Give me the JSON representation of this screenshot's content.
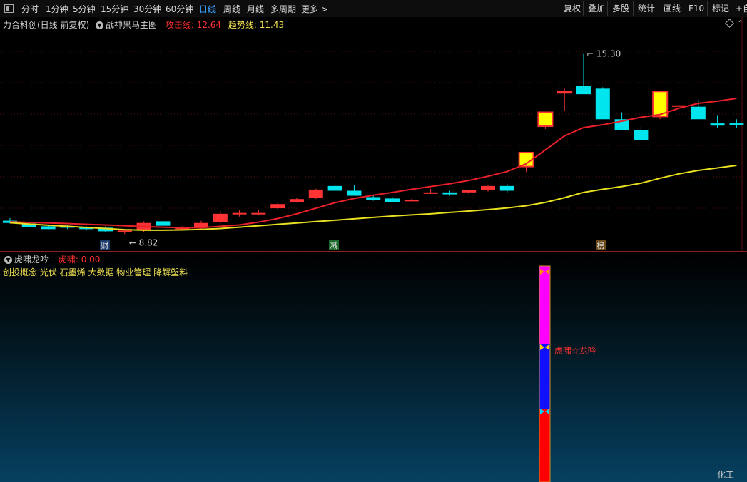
{
  "toolbar": {
    "periods": [
      "分时",
      "1分钟",
      "5分钟",
      "15分钟",
      "30分钟",
      "60分钟",
      "日线",
      "周线",
      "月线",
      "多周期",
      "更多 >"
    ],
    "active_period": "日线",
    "right_buttons": [
      "复权",
      "叠加",
      "多股",
      "统计",
      "画线",
      "F10",
      "标记",
      "+自"
    ]
  },
  "main": {
    "stock": "力合科创(日线 前复权)",
    "indicator": "战神黑马主图",
    "attack_label": "攻击线: 12.64",
    "trend_label": "趋势线: 11.43",
    "high_label": "15.30",
    "low_label": "8.82",
    "markers": [
      "财",
      "减",
      "榜"
    ]
  },
  "indicator_panel": {
    "name": "虎啸龙吟",
    "value_label": "虎啸: 0.00",
    "concepts": "创投概念 光伏 石墨烯 大数据 物业管理 降解塑料",
    "signal_text": "虎啸☆龙吟",
    "logo": "化工"
  },
  "colors": {
    "up": "#ff3333",
    "down": "#00e5ee",
    "surge": "#ffff00",
    "attack_line": "#e8202a",
    "trend_line": "#e8e020",
    "bar_magenta": "#ff00ff",
    "bar_blue": "#1010ff",
    "bar_red": "#ff0000"
  },
  "chart_data": {
    "type": "candlestick",
    "series": [
      {
        "name": "攻击线",
        "values": [
          9.26,
          9.24,
          9.22,
          9.2,
          9.17,
          9.15,
          9.12,
          9.09,
          9.07,
          9.05,
          9.05,
          9.1,
          9.15,
          9.25,
          9.38,
          9.55,
          9.75,
          9.95,
          10.1,
          10.22,
          10.32,
          10.43,
          10.53,
          10.63,
          10.75,
          10.9,
          11.07,
          11.35,
          11.85,
          12.35,
          12.65,
          12.75,
          12.88,
          13.02,
          13.12,
          13.35,
          13.52,
          13.6,
          13.7
        ]
      },
      {
        "name": "趋势线",
        "values": [
          9.23,
          9.18,
          9.14,
          9.1,
          9.06,
          9.02,
          8.98,
          8.96,
          8.96,
          8.97,
          8.99,
          9.02,
          9.07,
          9.12,
          9.17,
          9.22,
          9.27,
          9.32,
          9.37,
          9.42,
          9.47,
          9.51,
          9.55,
          9.6,
          9.65,
          9.7,
          9.76,
          9.84,
          9.96,
          10.13,
          10.32,
          10.43,
          10.53,
          10.65,
          10.83,
          10.99,
          11.11,
          11.2,
          11.29
        ]
      }
    ],
    "ohlc": [
      [
        9.3,
        9.4,
        9.2,
        9.22
      ],
      [
        9.2,
        9.25,
        9.08,
        9.08
      ],
      [
        9.1,
        9.15,
        9.0,
        9.0
      ],
      [
        9.1,
        9.15,
        9.0,
        9.05
      ],
      [
        9.05,
        9.1,
        8.95,
        9.0
      ],
      [
        9.05,
        9.1,
        8.9,
        8.92
      ],
      [
        8.92,
        8.98,
        8.82,
        8.95
      ],
      [
        8.95,
        9.28,
        8.9,
        9.22
      ],
      [
        9.28,
        9.3,
        9.12,
        9.12
      ],
      [
        9.05,
        9.1,
        8.98,
        9.05
      ],
      [
        9.05,
        9.3,
        9.0,
        9.22
      ],
      [
        9.25,
        9.65,
        9.2,
        9.55
      ],
      [
        9.55,
        9.68,
        9.45,
        9.58
      ],
      [
        9.55,
        9.7,
        9.5,
        9.58
      ],
      [
        9.75,
        9.95,
        9.72,
        9.9
      ],
      [
        9.98,
        10.12,
        9.95,
        10.08
      ],
      [
        10.12,
        10.45,
        10.08,
        10.42
      ],
      [
        10.55,
        10.62,
        10.38,
        10.38
      ],
      [
        10.38,
        10.58,
        10.2,
        10.2
      ],
      [
        10.15,
        10.2,
        10.02,
        10.05
      ],
      [
        10.1,
        10.15,
        9.98,
        9.98
      ],
      [
        10.02,
        10.08,
        10.0,
        10.05
      ],
      [
        10.3,
        10.45,
        10.28,
        10.32
      ],
      [
        10.32,
        10.38,
        10.2,
        10.25
      ],
      [
        10.32,
        10.38,
        10.25,
        10.4
      ],
      [
        10.4,
        10.58,
        10.35,
        10.55
      ],
      [
        10.55,
        10.62,
        10.3,
        10.38
      ],
      [
        11.25,
        11.75,
        11.05,
        11.75
      ],
      [
        12.7,
        13.2,
        12.6,
        13.2
      ],
      [
        13.9,
        14.05,
        13.25,
        13.95
      ],
      [
        14.15,
        15.3,
        13.85,
        13.85
      ],
      [
        14.05,
        14.1,
        12.95,
        12.95
      ],
      [
        12.95,
        13.2,
        12.55,
        12.55
      ],
      [
        12.55,
        12.68,
        12.2,
        12.2
      ],
      [
        13.05,
        13.95,
        12.95,
        13.95
      ],
      [
        13.45,
        13.45,
        13.4,
        13.45
      ],
      [
        13.4,
        13.65,
        12.95,
        12.95
      ],
      [
        12.8,
        13.1,
        12.65,
        12.72
      ],
      [
        12.8,
        12.95,
        12.65,
        12.75
      ]
    ],
    "ylim": [
      8.7,
      15.7
    ],
    "high": 15.3,
    "low": 8.82
  }
}
